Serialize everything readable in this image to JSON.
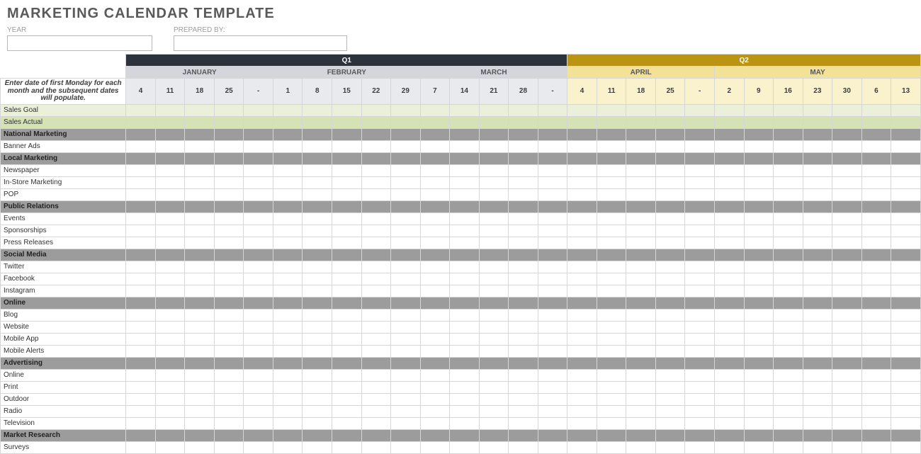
{
  "title": "MARKETING CALENDAR TEMPLATE",
  "form": {
    "year_label": "YEAR",
    "prepared_label": "PREPARED BY:",
    "year_value": "",
    "prepared_value": ""
  },
  "instruction": "Enter date of first Monday for each month and the subsequent dates will populate.",
  "quarters": [
    {
      "id": "q1",
      "label": "Q1",
      "class": "q1",
      "month_class": "m-q1",
      "date_class": "d-q1",
      "span": 15
    },
    {
      "id": "q2",
      "label": "Q2",
      "class": "q2",
      "month_class": "m-q2",
      "date_class": "d-q2",
      "span": 12
    }
  ],
  "months": [
    {
      "label": "JANUARY",
      "q": "q1",
      "span": 5
    },
    {
      "label": "FEBRUARY",
      "q": "q1",
      "span": 5
    },
    {
      "label": "MARCH",
      "q": "q1",
      "span": 5
    },
    {
      "label": "APRIL",
      "q": "q2",
      "span": 5
    },
    {
      "label": "MAY",
      "q": "q2",
      "span": 7
    }
  ],
  "dates": [
    "4",
    "11",
    "18",
    "25",
    "-",
    "1",
    "8",
    "15",
    "22",
    "29",
    "7",
    "14",
    "21",
    "28",
    "-",
    "4",
    "11",
    "18",
    "25",
    "-",
    "2",
    "9",
    "16",
    "23",
    "30",
    "6",
    "13"
  ],
  "rows": [
    {
      "label": "Sales Goal",
      "kind": "sales-goal"
    },
    {
      "label": "Sales Actual",
      "kind": "sales-actual"
    },
    {
      "label": "National Marketing",
      "kind": "cat"
    },
    {
      "label": "Banner Ads",
      "kind": "data"
    },
    {
      "label": "Local Marketing",
      "kind": "cat"
    },
    {
      "label": "Newspaper",
      "kind": "data"
    },
    {
      "label": "In-Store Marketing",
      "kind": "data"
    },
    {
      "label": "POP",
      "kind": "data"
    },
    {
      "label": "Public Relations",
      "kind": "cat"
    },
    {
      "label": "Events",
      "kind": "data"
    },
    {
      "label": "Sponsorships",
      "kind": "data"
    },
    {
      "label": "Press Releases",
      "kind": "data"
    },
    {
      "label": "Social Media",
      "kind": "cat"
    },
    {
      "label": "Twitter",
      "kind": "data"
    },
    {
      "label": "Facebook",
      "kind": "data"
    },
    {
      "label": "Instagram",
      "kind": "data"
    },
    {
      "label": "Online",
      "kind": "cat"
    },
    {
      "label": "Blog",
      "kind": "data"
    },
    {
      "label": "Website",
      "kind": "data"
    },
    {
      "label": "Mobile App",
      "kind": "data"
    },
    {
      "label": "Mobile Alerts",
      "kind": "data"
    },
    {
      "label": "Advertising",
      "kind": "cat"
    },
    {
      "label": "Online",
      "kind": "data"
    },
    {
      "label": "Print",
      "kind": "data"
    },
    {
      "label": "Outdoor",
      "kind": "data"
    },
    {
      "label": "Radio",
      "kind": "data"
    },
    {
      "label": "Television",
      "kind": "data"
    },
    {
      "label": "Market Research",
      "kind": "cat"
    },
    {
      "label": "Surveys",
      "kind": "data"
    }
  ]
}
